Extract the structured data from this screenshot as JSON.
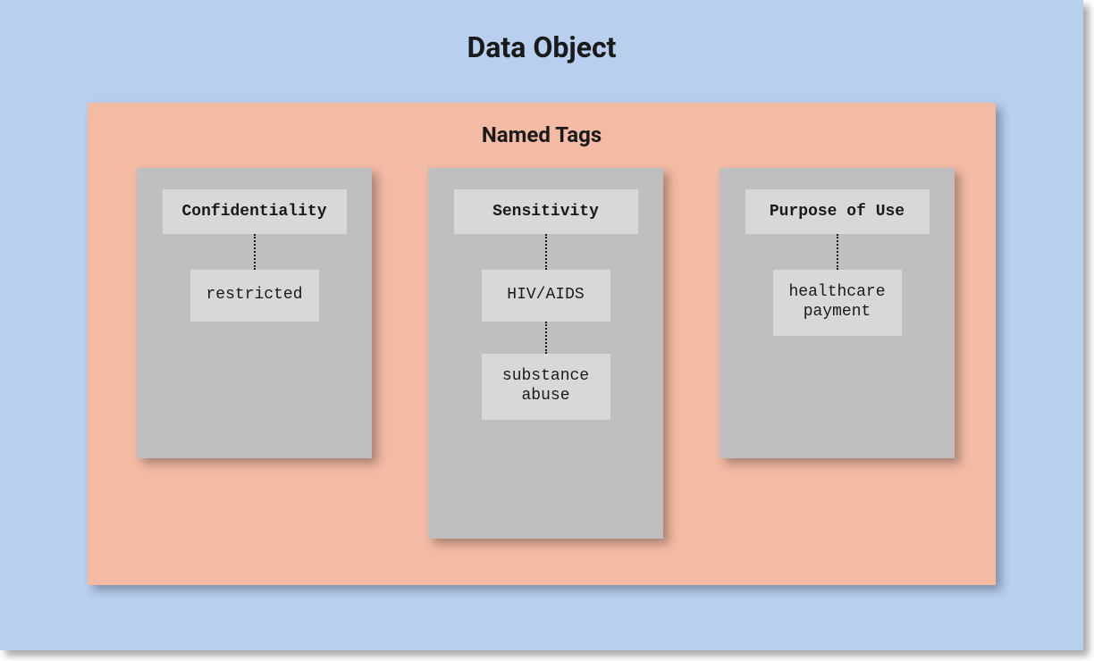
{
  "title": "Data Object",
  "container": {
    "title": "Named Tags"
  },
  "tags": [
    {
      "header": "Confidentiality",
      "values": [
        "restricted"
      ]
    },
    {
      "header": "Sensitivity",
      "values": [
        "HIV/AIDS",
        "substance abuse"
      ]
    },
    {
      "header": "Purpose of Use",
      "values": [
        "healthcare payment"
      ]
    }
  ]
}
